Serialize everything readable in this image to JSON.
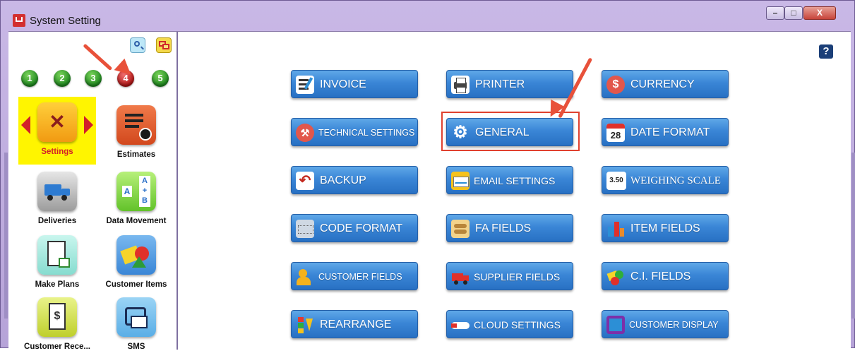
{
  "window": {
    "title": "System Setting",
    "min_label": "–",
    "max_label": "□",
    "close_label": "X"
  },
  "toolbar": {
    "search_icon": "search-icon",
    "window_icon": "windows-icon"
  },
  "pages": [
    {
      "label": "1",
      "color": "#1f8a20"
    },
    {
      "label": "2",
      "color": "#1f8a20"
    },
    {
      "label": "3",
      "color": "#1f8a20"
    },
    {
      "label": "4",
      "color": "#b01515",
      "active": true
    },
    {
      "label": "5",
      "color": "#1f8a20"
    }
  ],
  "modules": [
    {
      "label": "Settings",
      "icon": "wrench-screwdriver-icon",
      "selected": true
    },
    {
      "label": "Estimates",
      "icon": "estimate-document-icon"
    },
    {
      "label": "Deliveries",
      "icon": "delivery-truck-icon"
    },
    {
      "label": "Data Movement",
      "icon": "data-movement-icon"
    },
    {
      "label": "Make Plans",
      "icon": "clipboard-plan-icon"
    },
    {
      "label": "Customer Items",
      "icon": "shapes-icon"
    },
    {
      "label": "Customer Rece...",
      "icon": "receipt-icon"
    },
    {
      "label": "SMS",
      "icon": "sms-envelope-icon"
    }
  ],
  "buttons": {
    "invoice": "INVOICE",
    "printer": "PRINTER",
    "currency": "CURRENCY",
    "technical_settings": "TECHNICAL SETTINGS",
    "general": "GENERAL",
    "date_format": "DATE FORMAT",
    "date_badge": "28",
    "backup": "BACKUP",
    "email_settings": "EMAIL SETTINGS",
    "weighing_scale": "WEIGHING SCALE",
    "weighing_badge": "3.50",
    "code_format": "CODE FORMAT",
    "fa_fields": "FA FIELDS",
    "item_fields": "ITEM FIELDS",
    "customer_fields": "CUSTOMER FIELDS",
    "supplier_fields": "SUPPLIER FIELDS",
    "ci_fields": "C.I. FIELDS",
    "rearrange": "REARRANGE",
    "cloud_settings": "CLOUD SETTINGS",
    "customer_display": "CUSTOMER DISPLAY"
  },
  "help": {
    "label": "?"
  },
  "colors": {
    "accent_button": "#3a86d6",
    "highlight": "#e0412f",
    "selected_bg": "#fff500"
  }
}
